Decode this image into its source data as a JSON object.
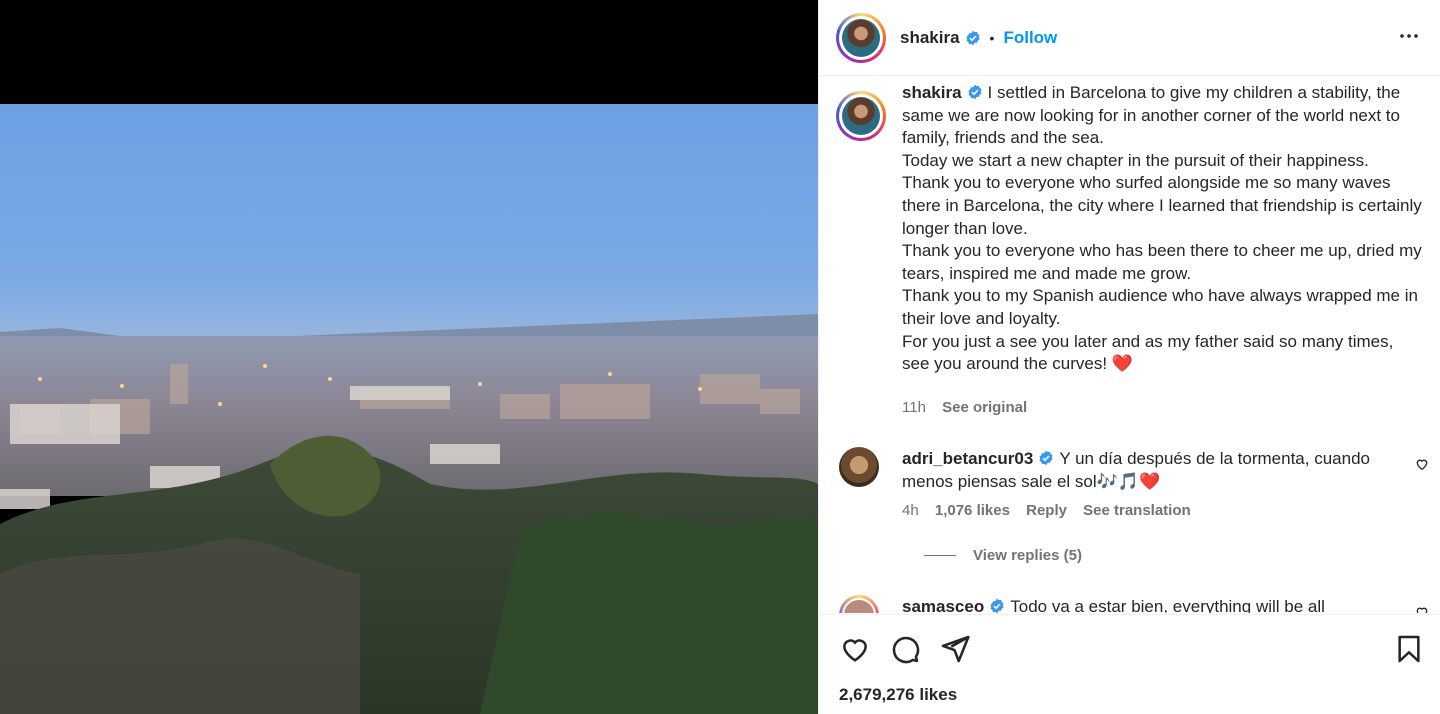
{
  "post": {
    "username": "shakira",
    "follow_label": "Follow",
    "separator": "•"
  },
  "caption": {
    "username": "shakira",
    "text": "I settled in Barcelona to give my children a stability, the same we are now looking for in another corner of the world next to family, friends and the sea.\nToday we start a new chapter in the pursuit of their happiness.\nThank you to everyone who surfed alongside me so many waves there in Barcelona, the city where I learned that friendship is certainly longer than love.\nThank you to everyone who has been there to cheer me up, dried my tears, inspired me and made me grow.\nThank you to my Spanish audience who have always wrapped me in their love and loyalty.\nFor you just a see you later and as my father said so many times, see you around the curves! ❤️",
    "time": "11h",
    "see_original": "See original"
  },
  "comments": [
    {
      "username": "adri_betancur03",
      "text": "Y un día después de la tormenta, cuando menos piensas sale el sol🎶🎵❤️",
      "time": "4h",
      "likes": "1,076 likes",
      "reply": "Reply",
      "see_translation": "See translation",
      "view_replies": "View replies (5)"
    },
    {
      "username": "samasceo",
      "text": "Todo va a estar bien, everything will be all"
    }
  ],
  "footer": {
    "likes": "2,679,276 likes"
  },
  "icons": {
    "verified": "verified-badge-icon",
    "more": "more-options-icon",
    "like": "heart-icon",
    "comment": "comment-icon",
    "share": "share-icon",
    "save": "bookmark-icon"
  },
  "colors": {
    "follow": "#0095f6",
    "verified": "#3897f0",
    "heart": "#ed4956"
  }
}
